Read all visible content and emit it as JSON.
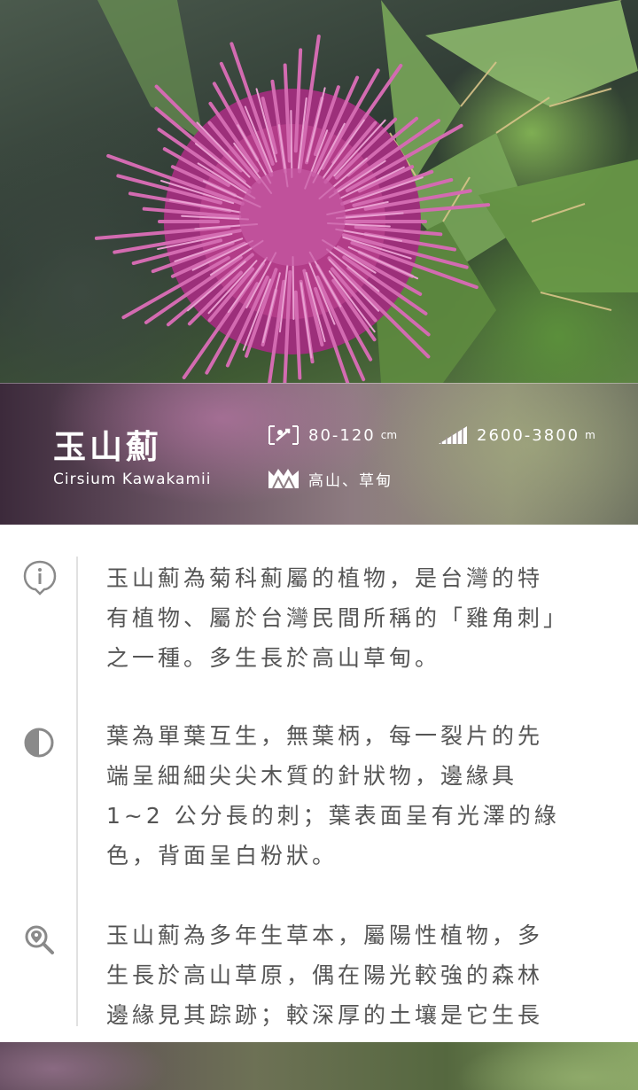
{
  "plant": {
    "name": "玉山薊",
    "latin_name": "Cirsium Kawakamii"
  },
  "stats": {
    "height": {
      "value": "80-120",
      "unit": "cm",
      "icon": "height-icon"
    },
    "altitude": {
      "value": "2600-3800",
      "unit": "m",
      "icon": "altitude-icon"
    },
    "habitat": {
      "value": "高山、草甸",
      "icon": "mountains-icon"
    }
  },
  "sections": [
    {
      "icon": "info-icon",
      "lines": [
        "玉山薊為菊科薊屬的植物，是台灣的特",
        "有植物、屬於台灣民間所稱的「雞角刺」",
        "之一種。多生長於高山草甸。"
      ]
    },
    {
      "icon": "half-circle-icon",
      "lines": [
        "葉為單葉互生，無葉柄，每一裂片的先",
        "端呈細細尖尖木質的針狀物，邊緣具",
        "1~2 公分長的刺；葉表面呈有光澤的綠",
        "色，背面呈白粉狀。"
      ]
    },
    {
      "icon": "location-search-icon",
      "lines": [
        "玉山薊為多年生草本，屬陽性植物，多",
        "生長於高山草原，偶在陽光較強的森林",
        "邊緣見其踪跡；較深厚的土壤是它生長"
      ]
    }
  ],
  "colors": {
    "flower": "#b6357f",
    "text": "#555555",
    "divider": "#e1e1e1",
    "icon": "#8a8a8a"
  }
}
